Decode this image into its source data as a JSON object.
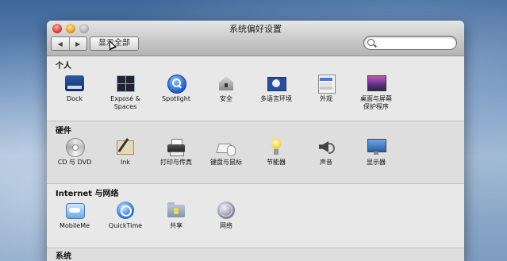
{
  "window": {
    "title": "系统偏好设置",
    "nav_back": "◀",
    "nav_forward": "▶",
    "show_all_label": "显示全部",
    "search": {
      "value": "",
      "placeholder": ""
    }
  },
  "sections": {
    "personal": {
      "title": "个人",
      "items": [
        {
          "label": "Dock",
          "icon": "dock-icon"
        },
        {
          "label": "Exposé & Spaces",
          "icon": "expose-spaces-icon"
        },
        {
          "label": "Spotlight",
          "icon": "spotlight-icon"
        },
        {
          "label": "安全",
          "icon": "security-icon"
        },
        {
          "label": "多语言环境",
          "icon": "international-icon"
        },
        {
          "label": "外观",
          "icon": "appearance-icon"
        },
        {
          "label": "桌面与屏幕保护程序",
          "icon": "desktop-screensaver-icon"
        }
      ]
    },
    "hardware": {
      "title": "硬件",
      "items": [
        {
          "label": "CD 与 DVD",
          "icon": "cd-dvd-icon"
        },
        {
          "label": "Ink",
          "icon": "ink-icon"
        },
        {
          "label": "打印与传真",
          "icon": "print-fax-icon"
        },
        {
          "label": "键盘与鼠标",
          "icon": "keyboard-mouse-icon"
        },
        {
          "label": "节能器",
          "icon": "energy-saver-icon"
        },
        {
          "label": "声音",
          "icon": "sound-icon"
        },
        {
          "label": "显示器",
          "icon": "displays-icon"
        }
      ]
    },
    "internet": {
      "title": "Internet 与网络",
      "items": [
        {
          "label": "MobileMe",
          "icon": "mobileme-icon"
        },
        {
          "label": "QuickTime",
          "icon": "quicktime-icon"
        },
        {
          "label": "共享",
          "icon": "sharing-icon"
        },
        {
          "label": "网络",
          "icon": "network-icon"
        }
      ]
    },
    "system": {
      "title": "系统"
    }
  }
}
